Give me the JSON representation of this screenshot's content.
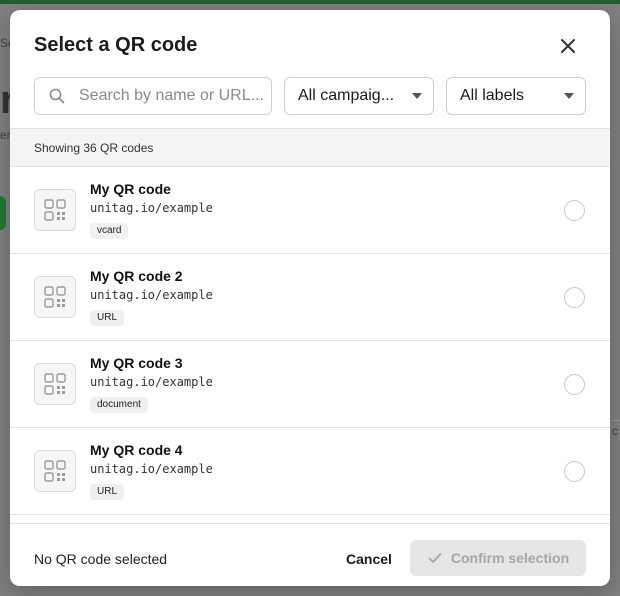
{
  "background": {
    "fragment_top": "Sc",
    "fragment_big": "r",
    "fragment_small": "er",
    "fragment_right": "c"
  },
  "modal": {
    "title": "Select a QR code",
    "close_icon": "close-icon"
  },
  "search": {
    "placeholder": "Search by name or URL...",
    "icon": "search-icon"
  },
  "filters": {
    "campaigns_label": "All campaig...",
    "labels_label": "All labels"
  },
  "list": {
    "count_text": "Showing 36 QR codes",
    "items": [
      {
        "name": "My QR code",
        "url": "unitag.io/example",
        "badge": "vcard"
      },
      {
        "name": "My QR code 2",
        "url": "unitag.io/example",
        "badge": "URL"
      },
      {
        "name": "My QR code 3",
        "url": "unitag.io/example",
        "badge": "document"
      },
      {
        "name": "My QR code 4",
        "url": "unitag.io/example",
        "badge": "URL"
      }
    ]
  },
  "footer": {
    "status": "No QR code selected",
    "cancel_label": "Cancel",
    "confirm_label": "Confirm selection"
  },
  "colors": {
    "accent": "#1f7a3a",
    "disabled_bg": "#e6e6e6",
    "disabled_text": "#a6a6a6"
  }
}
